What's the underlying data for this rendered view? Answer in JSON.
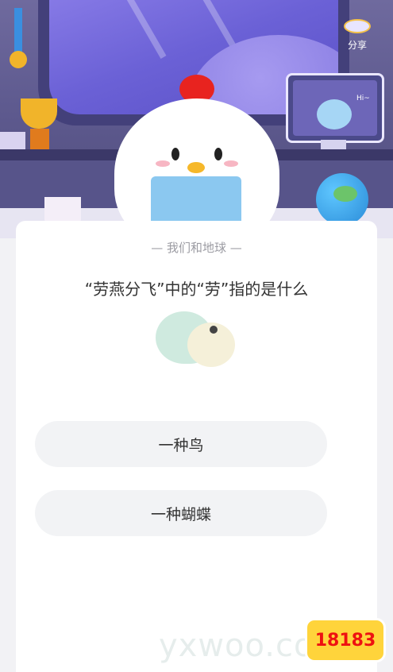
{
  "header": {
    "share_label": "分享",
    "monitor_text": "Hi~"
  },
  "quiz": {
    "category": "— 我们和地球 —",
    "question": "“劳燕分飞”中的“劳”指的是什么",
    "options": [
      {
        "label": "一种鸟"
      },
      {
        "label": "一种蝴蝶"
      }
    ]
  },
  "watermark": {
    "text": "yxwoo.com",
    "logo_text": "18183"
  },
  "colors": {
    "hero_bg": "#5e5a8f",
    "option_bg": "#f2f3f5",
    "card_bg": "#ffffff",
    "comb": "#e8231f"
  },
  "icons": {
    "share": "ufo-icon",
    "mascot": "chick-mascot",
    "illustration": "snail-icon"
  }
}
